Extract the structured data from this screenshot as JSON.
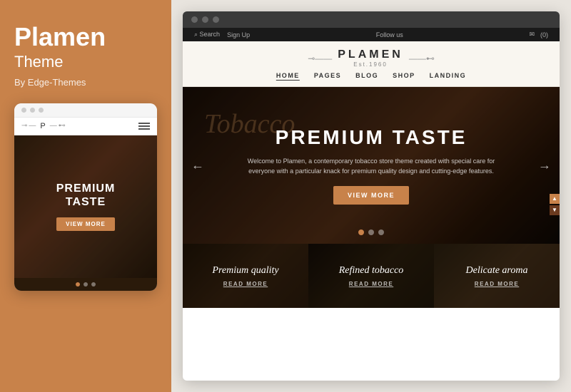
{
  "left": {
    "title": "Plamen",
    "subtitle": "Theme",
    "author": "By Edge-Themes",
    "mobile": {
      "dots": [
        "active",
        "inactive",
        "inactive"
      ],
      "hero_text_line1": "PREMIUM",
      "hero_text_line2": "TASTE",
      "btn_label": "VIEW MORE",
      "logo_name": "P",
      "logo_deco_left": "⊸—",
      "logo_deco_right": "—⊷"
    }
  },
  "right": {
    "browser_dots": [
      "●",
      "●",
      "●"
    ],
    "site": {
      "topbar_left": [
        "⌕ Search",
        "Sign Up"
      ],
      "topbar_center": "Follow us",
      "topbar_right": [
        "✉",
        "(0)"
      ],
      "logo_name": "PLAMEN",
      "logo_est": "Est.1960",
      "nav_links": [
        "HOME",
        "PAGES",
        "BLOG",
        "SHOP",
        "LANDING"
      ],
      "nav_active": "HOME",
      "hero_script": "Tobacco",
      "hero_title": "PREMIUM TASTE",
      "hero_desc": "Welcome to Plamen, a contemporary tobacco store theme created with special care for everyone with a particular knack for premium quality design and cutting-edge features.",
      "hero_btn": "VIEW MORE",
      "slide_dots": [
        "active",
        "inactive",
        "inactive"
      ],
      "feature_boxes": [
        {
          "title": "Premium quality",
          "link": "READ MORE"
        },
        {
          "title": "Refined tobacco",
          "link": "READ MORE"
        },
        {
          "title": "Delicate aroma",
          "link": "READ MORE"
        }
      ],
      "scroll_up": "▲",
      "scroll_down": "▼"
    }
  }
}
